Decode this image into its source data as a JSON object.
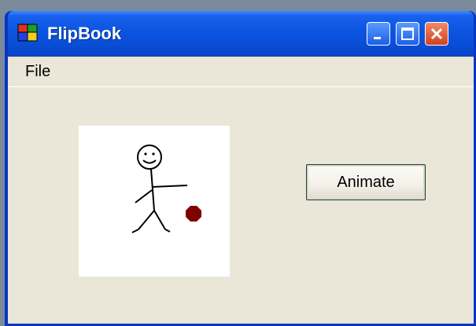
{
  "window": {
    "title": "FlipBook"
  },
  "menu": {
    "items": [
      "File"
    ]
  },
  "buttons": {
    "animate_label": "Animate"
  },
  "colors": {
    "ball": "#800000",
    "titlebar": "#0a54e0",
    "client_bg": "#ebe7d8"
  }
}
